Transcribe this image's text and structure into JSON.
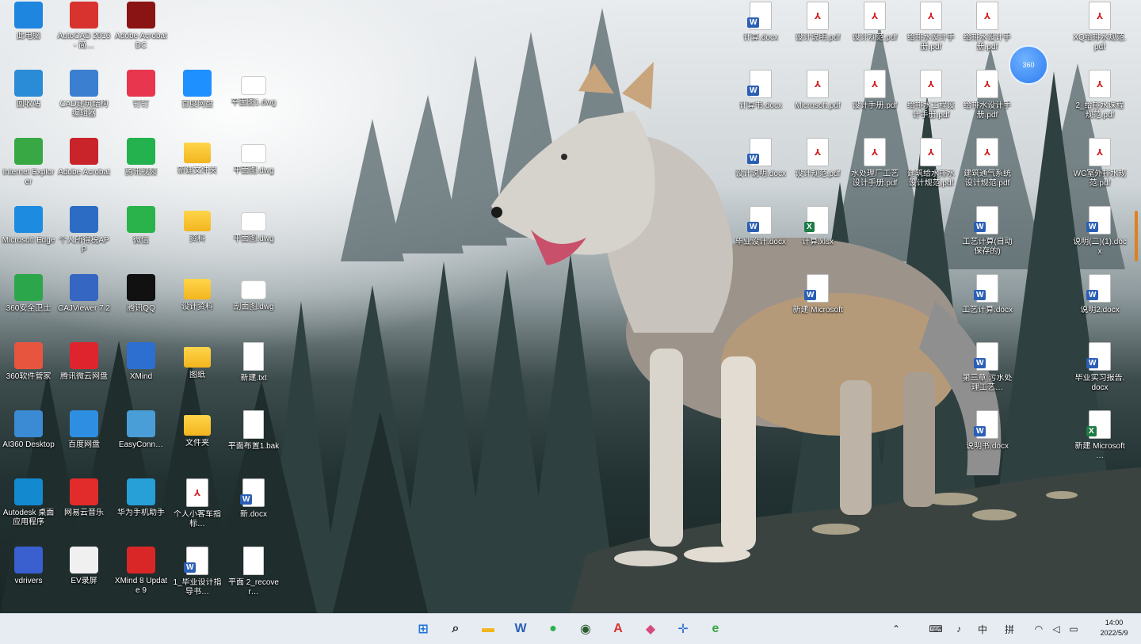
{
  "desktop": {
    "left_column_1": [
      {
        "label": "此电脑",
        "icon": "computer-icon",
        "color": "#1f86e0"
      },
      {
        "label": "回收站",
        "icon": "recycle-bin-icon",
        "color": "#2a8bd6"
      },
      {
        "label": "Internet Explorer",
        "icon": "ie-icon",
        "color": "#37a844"
      },
      {
        "label": "Microsoft Edge",
        "icon": "edge-icon",
        "color": "#1c8be0"
      },
      {
        "label": "360安全卫士",
        "icon": "360-icon",
        "color": "#2ca64a"
      },
      {
        "label": "360软件管家",
        "icon": "store-icon",
        "color": "#e8553f"
      },
      {
        "label": "AI360 Desktop",
        "icon": "desktop-app-icon",
        "color": "#3a8bd4"
      },
      {
        "label": "Autodesk 桌面应用程序",
        "icon": "autodesk-icon",
        "color": "#138ad0"
      },
      {
        "label": "vdrivers",
        "icon": "doc-app-icon",
        "color": "#3a5fcf"
      }
    ],
    "left_column_2": [
      {
        "label": "AutoCAD 2016 - 简…",
        "icon": "autocad-icon",
        "color": "#d8332f"
      },
      {
        "label": "CAD建筑结构编辑器",
        "icon": "cad-tool-icon",
        "color": "#3b7fd0"
      },
      {
        "label": "Adobe Acrobat",
        "icon": "acrobat-icon",
        "color": "#c8242a"
      },
      {
        "label": "个人所得税APP",
        "icon": "tax-icon",
        "color": "#2d6cc5"
      },
      {
        "label": "CAJViewer 7.2",
        "icon": "cajviewer-icon",
        "color": "#3566c2"
      },
      {
        "label": "腾讯微云网盘",
        "icon": "cloud-red-icon",
        "color": "#e0242e"
      },
      {
        "label": "百度网盘",
        "icon": "baidu-cloud-icon",
        "color": "#2e8fe2"
      },
      {
        "label": "网易云音乐",
        "icon": "netease-music-icon",
        "color": "#e22b2b"
      },
      {
        "label": "EV录屏",
        "icon": "ev-recorder-icon",
        "color": "#f0f0f0"
      }
    ],
    "left_column_3": [
      {
        "label": "Adobe Acrobat DC",
        "icon": "acrobat-dc-icon",
        "color": "#8a1414"
      },
      {
        "label": "钉钉",
        "icon": "dingtalk-icon",
        "color": "#e8364f"
      },
      {
        "label": "腾讯视频",
        "icon": "video-player-icon",
        "color": "#23b24d"
      },
      {
        "label": "微信",
        "icon": "wechat-icon",
        "color": "#2ab24b"
      },
      {
        "label": "腾讯QQ",
        "icon": "qq-icon",
        "color": "#111111"
      },
      {
        "label": "XMind",
        "icon": "compass-icon",
        "color": "#2c6fd1"
      },
      {
        "label": "EasyConn…",
        "icon": "easyconn-icon",
        "color": "#4a9ed8"
      },
      {
        "label": "华为手机助手",
        "icon": "phone-assistant-icon",
        "color": "#27a0d8"
      },
      {
        "label": "XMind 8 Update 9",
        "icon": "xmind-icon",
        "color": "#d92727"
      }
    ],
    "left_column_4": [
      {
        "label": "百度网盘",
        "icon": "cloud-app-icon",
        "color": "#1e90ff"
      },
      {
        "label": "新建文件夹",
        "icon": "folder-icon",
        "kind": "folder"
      },
      {
        "label": "资料",
        "icon": "folder-icon",
        "kind": "folder"
      },
      {
        "label": "设计资料",
        "icon": "folder-icon",
        "kind": "folder"
      },
      {
        "label": "图纸",
        "icon": "folder-icon",
        "kind": "folder"
      },
      {
        "label": "文件夹",
        "icon": "folder-icon",
        "kind": "folder"
      },
      {
        "label": "个人小客车指标…",
        "icon": "pdf-icon",
        "kind": "pdf"
      },
      {
        "label": "1_毕业设计指导书…",
        "icon": "docx-icon",
        "kind": "docx"
      }
    ],
    "left_column_5": [
      {
        "label": "平面图1.dwg",
        "icon": "image-file-icon",
        "kind": "img"
      },
      {
        "label": "平面图.dwg",
        "icon": "image-file-icon",
        "kind": "img"
      },
      {
        "label": "平面图.dwg",
        "icon": "image-file-icon",
        "kind": "img"
      },
      {
        "label": "剖面图.dwg",
        "icon": "image-file-icon",
        "kind": "img"
      },
      {
        "label": "新建.txt",
        "icon": "file-icon",
        "kind": "file"
      },
      {
        "label": "平面布置1.bak",
        "icon": "file-icon",
        "kind": "file"
      },
      {
        "label": "新.docx",
        "icon": "docx-icon",
        "kind": "docx"
      },
      {
        "label": "平面 2_recover…",
        "icon": "file-icon",
        "kind": "file"
      }
    ],
    "right_area": [
      {
        "label": "计算.docx",
        "icon": "docx-icon",
        "kind": "docx",
        "col": 0,
        "row": 0
      },
      {
        "label": "设计说明.pdf",
        "icon": "pdf-icon",
        "kind": "pdf",
        "col": 1,
        "row": 0
      },
      {
        "label": "设计规范.pdf",
        "icon": "pdf-icon",
        "kind": "pdf",
        "col": 2,
        "row": 0
      },
      {
        "label": "给排水设计手册.pdf",
        "icon": "pdf-icon",
        "kind": "pdf",
        "col": 3,
        "row": 0
      },
      {
        "label": "给排水设计手册.pdf",
        "icon": "pdf-icon",
        "kind": "pdf",
        "col": 4,
        "row": 0
      },
      {
        "label": "XQ给排水规范.pdf",
        "icon": "pdf-icon",
        "kind": "pdf",
        "col": 6,
        "row": 0
      },
      {
        "label": "计算书.docx",
        "icon": "docx-icon",
        "kind": "docx",
        "col": 0,
        "row": 1
      },
      {
        "label": "Microsoft.pdf",
        "icon": "pdf-icon",
        "kind": "pdf",
        "col": 1,
        "row": 1
      },
      {
        "label": "设计手册.pdf",
        "icon": "pdf-icon",
        "kind": "pdf",
        "col": 2,
        "row": 1
      },
      {
        "label": "给排水工程设计手册.pdf",
        "icon": "pdf-icon",
        "kind": "pdf",
        "col": 3,
        "row": 1
      },
      {
        "label": "给排水设计手册.pdf",
        "icon": "pdf-icon",
        "kind": "pdf",
        "col": 4,
        "row": 1
      },
      {
        "label": "2_给排水课程规范.pdf",
        "icon": "pdf-icon",
        "kind": "pdf",
        "col": 6,
        "row": 1
      },
      {
        "label": "设计说明.docx",
        "icon": "docx-icon",
        "kind": "docx",
        "col": 0,
        "row": 2
      },
      {
        "label": "设计规范.pdf",
        "icon": "pdf-icon",
        "kind": "pdf",
        "col": 1,
        "row": 2
      },
      {
        "label": "水处理厂工艺设计手册.pdf",
        "icon": "pdf-icon",
        "kind": "pdf",
        "col": 2,
        "row": 2
      },
      {
        "label": "建筑给水排水设计规范.pdf",
        "icon": "pdf-icon",
        "kind": "pdf",
        "col": 3,
        "row": 2
      },
      {
        "label": "建筑通气系统设计规范.pdf",
        "icon": "pdf-icon",
        "kind": "pdf",
        "col": 4,
        "row": 2
      },
      {
        "label": "WC室外排水规范.pdf",
        "icon": "pdf-icon",
        "kind": "pdf",
        "col": 6,
        "row": 2
      },
      {
        "label": "毕业设计.docx",
        "icon": "docx-icon",
        "kind": "docx",
        "col": 0,
        "row": 3
      },
      {
        "label": "计算.xlsx",
        "icon": "xlsx-icon",
        "kind": "xlsx",
        "col": 1,
        "row": 3
      },
      {
        "label": "工艺计算(自动保存的)",
        "icon": "docx-icon",
        "kind": "docx",
        "col": 4,
        "row": 3
      },
      {
        "label": "说明(二)(1).docx",
        "icon": "docx-icon",
        "kind": "docx",
        "col": 6,
        "row": 3
      },
      {
        "label": "新建 Microsoft",
        "icon": "docx-icon",
        "kind": "docx",
        "col": 1,
        "row": 4
      },
      {
        "label": "工艺计算.docx",
        "icon": "docx-icon",
        "kind": "docx",
        "col": 4,
        "row": 4
      },
      {
        "label": "说明2.docx",
        "icon": "docx-icon",
        "kind": "docx",
        "col": 6,
        "row": 4
      },
      {
        "label": "第三章 污水处理工艺…",
        "icon": "docx-icon",
        "kind": "docx",
        "col": 4,
        "row": 5
      },
      {
        "label": "毕业实习报告.docx",
        "icon": "docx-icon",
        "kind": "docx",
        "col": 6,
        "row": 5
      },
      {
        "label": "说明书.docx",
        "icon": "docx-icon",
        "kind": "docx",
        "col": 4,
        "row": 6
      },
      {
        "label": "新建 Microsoft …",
        "icon": "xlsx-icon",
        "kind": "xlsx",
        "col": 6,
        "row": 6
      }
    ],
    "assistant_bubble": {
      "label": "360",
      "icon": "assistant-bubble-icon"
    }
  },
  "taskbar": {
    "apps": [
      {
        "name": "start-button",
        "icon": "windows-start-icon",
        "glyph": "⊞",
        "color": "#1f73d6"
      },
      {
        "name": "search-button",
        "icon": "search-icon",
        "glyph": "⌕",
        "color": "#222222"
      },
      {
        "name": "file-explorer-button",
        "icon": "folder-icon",
        "glyph": "▬",
        "color": "#f2b51e"
      },
      {
        "name": "word-button",
        "icon": "word-icon",
        "glyph": "W",
        "color": "#2b5fb5"
      },
      {
        "name": "wechat-button",
        "icon": "wechat-icon",
        "glyph": "●",
        "color": "#2ab24b"
      },
      {
        "name": "green-app-button",
        "icon": "green-circle-app-icon",
        "glyph": "◉",
        "color": "#2b5a2c"
      },
      {
        "name": "autocad-button",
        "icon": "autocad-icon",
        "glyph": "A",
        "color": "#d8332f"
      },
      {
        "name": "browser-button",
        "icon": "browser-icon",
        "glyph": "◆",
        "color": "#d84a7d"
      },
      {
        "name": "xmind-button",
        "icon": "compass-icon",
        "glyph": "✛",
        "color": "#2c6fd1"
      },
      {
        "name": "ie-button",
        "icon": "ie-icon",
        "glyph": "e",
        "color": "#37a844"
      }
    ],
    "tray": [
      {
        "name": "tray-chevron",
        "icon": "chevron-up-icon",
        "glyph": "⌃"
      },
      {
        "name": "tray-keyboard",
        "icon": "keyboard-icon",
        "glyph": "⌨"
      },
      {
        "name": "tray-mic",
        "icon": "microphone-icon",
        "glyph": "♪"
      },
      {
        "name": "tray-ime",
        "icon": "ime-icon",
        "glyph": "中"
      },
      {
        "name": "tray-pinyin",
        "icon": "pinyin-icon",
        "glyph": "拼"
      },
      {
        "name": "tray-wifi",
        "icon": "wifi-icon",
        "glyph": "◠"
      },
      {
        "name": "tray-volume",
        "icon": "volume-icon",
        "glyph": "◁"
      },
      {
        "name": "tray-battery",
        "icon": "battery-icon",
        "glyph": "▭"
      }
    ],
    "clock": {
      "time": "14:00",
      "date": "2022/5/9"
    }
  }
}
